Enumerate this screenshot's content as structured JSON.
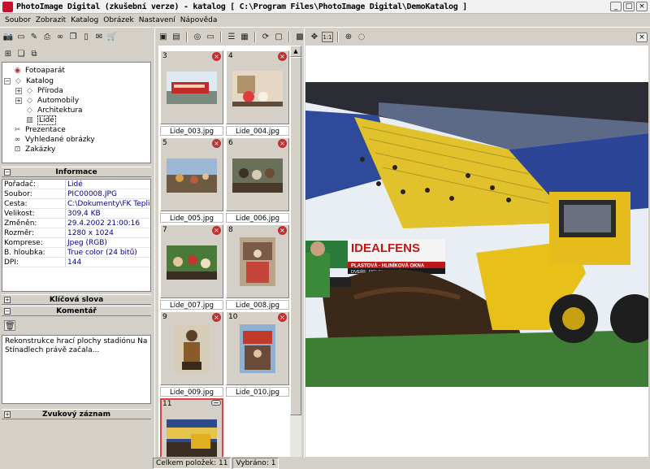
{
  "window": {
    "title": "PhotoImage Digital (zkušební verze) - katalog [ C:\\Program Files\\PhotoImage Digital\\DemoKatalog ]"
  },
  "menu": [
    "Soubor",
    "Zobrazit",
    "Katalog",
    "Obrázek",
    "Nastavení",
    "Nápověda"
  ],
  "tree": {
    "root": "Fotoaparát",
    "catalog": "Katalog",
    "children": [
      "Příroda",
      "Automobily",
      "Architektura",
      "Lidé"
    ],
    "presentations": "Prezentace",
    "found": "Vyhledané obrázky",
    "orders": "Zakázky"
  },
  "info": {
    "title": "Informace",
    "rows": [
      {
        "k": "Pořadač:",
        "v": "Lidé"
      },
      {
        "k": "Soubor:",
        "v": "PIC00008.JPG"
      },
      {
        "k": "Cesta:",
        "v": "C:\\Dokumenty\\FK Teplice\\"
      },
      {
        "k": "Velikost:",
        "v": "309,4 KB"
      },
      {
        "k": "Změněn:",
        "v": "29.4.2002 21:00:16"
      },
      {
        "k": "Rozměr:",
        "v": "1280 x 1024"
      },
      {
        "k": "Komprese:",
        "v": "Jpeg (RGB)"
      },
      {
        "k": "B. hloubka:",
        "v": "True color (24 bitů)"
      },
      {
        "k": "DPI:",
        "v": "144"
      }
    ]
  },
  "sections": {
    "keywords": "Klíčová slova",
    "comment": "Komentář",
    "audio": "Zvukový záznam"
  },
  "comment_text": "Rekonstrukce hrací plochy stadiónu Na Stínadlech právě začala...",
  "thumbnails": [
    {
      "num": "3",
      "name": "Lide_003.jpg"
    },
    {
      "num": "4",
      "name": "Lide_004.jpg"
    },
    {
      "num": "5",
      "name": "Lide_005.jpg"
    },
    {
      "num": "6",
      "name": "Lide_006.jpg"
    },
    {
      "num": "7",
      "name": "Lide_007.jpg"
    },
    {
      "num": "8",
      "name": "Lide_008.jpg"
    },
    {
      "num": "9",
      "name": "Lide_009.jpg"
    },
    {
      "num": "10",
      "name": "Lide_010.jpg"
    },
    {
      "num": "11",
      "name": ""
    }
  ],
  "photo": {
    "banner": "IDEALFENS",
    "banner2": "PLASTOVÁ - HLINÍKOVÁ OKNA",
    "banner3": "DVEŘE, ROLETY, ZIMNÍ ZA"
  },
  "status": {
    "total": "Celkem položek: 11",
    "selected": "Vybráno: 1"
  },
  "colors": {
    "accent": "#c8102e",
    "delete": "#c03030",
    "selection": "#e04040"
  }
}
